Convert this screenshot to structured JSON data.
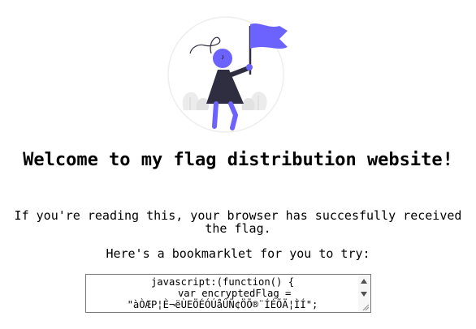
{
  "page": {
    "heading": "Welcome to my flag distribution website!",
    "paragraph_1": "If you're reading this, your browser has succesfully received the flag.",
    "paragraph_2": "Here's a bookmarklet for you to try:"
  },
  "bookmarklet": {
    "line_1": "javascript:(function() {",
    "line_2": "    var encryptedFlag =",
    "line_3": "\"àÒÆP¦È¬ëÙEÖÉÓÚåÛÑ¢ÖÕ®¨ÍÉÕÄ¦ÌÍ\";"
  },
  "illustration": {
    "icon": "person-with-flag-illustration",
    "colors": {
      "accent": "#6c63ff",
      "dark": "#2f2e41",
      "circle": "#f2f2f2",
      "foliage": "#e6e6e6"
    }
  },
  "scrollbar": {
    "icons": [
      "scroll-up-arrow-icon",
      "scroll-down-arrow-icon",
      "resize-grip-icon"
    ]
  }
}
